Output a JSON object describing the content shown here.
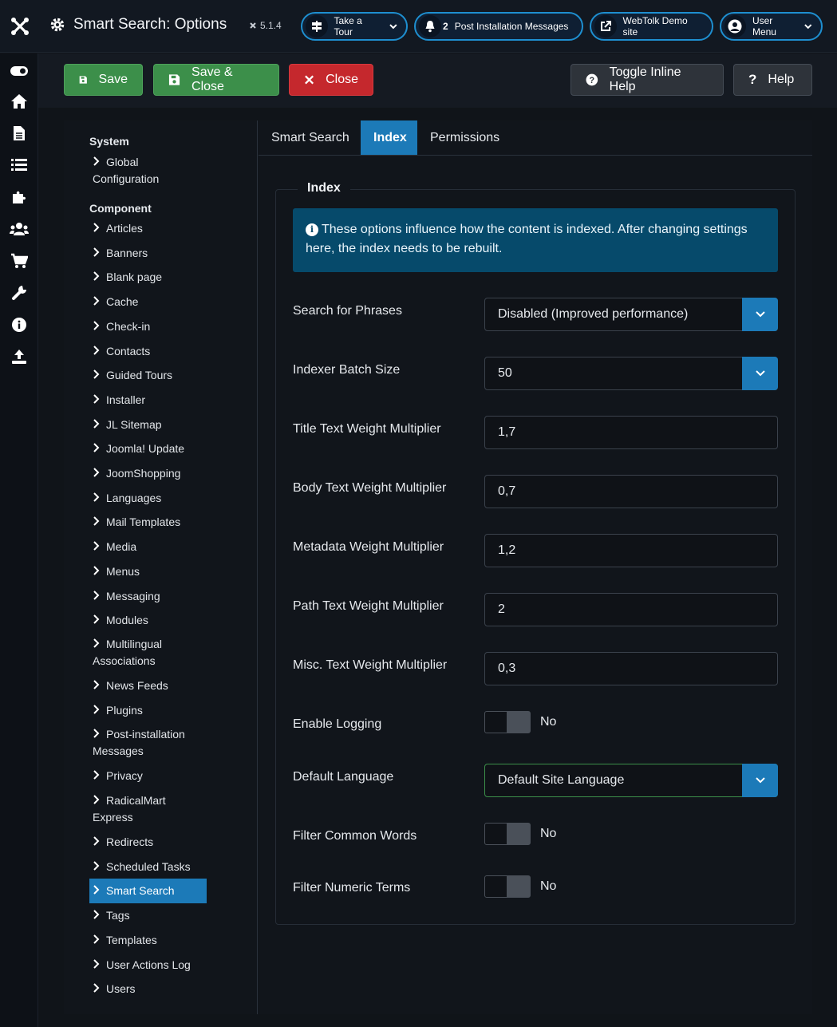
{
  "header": {
    "title": "Smart Search: Options",
    "version": "5.1.4",
    "tour_label": "Take a Tour",
    "notifications_count": "2",
    "notifications_label": "Post Installation Messages",
    "site_label": "WebTolk Demo site",
    "user_menu_label": "User Menu"
  },
  "sidebar_icons": [
    "toggle-icon",
    "home-icon",
    "file-icon",
    "list-icon",
    "puzzle-icon",
    "users-icon",
    "cart-icon",
    "wrench-icon",
    "info-icon",
    "upload-icon"
  ],
  "toolbar": {
    "save": "Save",
    "save_close": "Save & Close",
    "close": "Close",
    "toggle_help": "Toggle Inline Help",
    "help": "Help"
  },
  "nav": {
    "system_heading": "System",
    "global_line1": "Global",
    "global_line2": "Configuration",
    "component_heading": "Component",
    "items": [
      "Articles",
      "Banners",
      "Blank page",
      "Cache",
      "Check-in",
      "Contacts",
      "Guided Tours",
      "Installer",
      "JL Sitemap",
      "Joomla! Update",
      "JoomShopping",
      "Languages",
      "Mail Templates",
      "Media",
      "Menus",
      "Messaging",
      "Modules"
    ],
    "multilingual_line1": "Multilingual",
    "multilingual_line2": "Associations",
    "items2": [
      "News Feeds",
      "Plugins"
    ],
    "postinstall_line1": "Post-installation",
    "postinstall_line2": "Messages",
    "privacy": "Privacy",
    "radical_line1": "RadicalMart",
    "radical_line2": "Express",
    "items3": [
      "Redirects",
      "Scheduled Tasks",
      "Smart Search",
      "Tags",
      "Templates",
      "User Actions Log",
      "Users"
    ],
    "active": "Smart Search"
  },
  "tabs": [
    "Smart Search",
    "Index",
    "Permissions"
  ],
  "active_tab": "Index",
  "form": {
    "legend": "Index",
    "alert_line1": "These options influence how the content is indexed. After changing settings",
    "alert_line2": "here, the index needs to be rebuilt.",
    "fields": {
      "phrases": {
        "label": "Search for Phrases",
        "value": "Disabled (Improved performance)"
      },
      "batch": {
        "label": "Indexer Batch Size",
        "value": "50"
      },
      "title_weight": {
        "label": "Title Text Weight Multiplier",
        "value": "1,7"
      },
      "body_weight": {
        "label": "Body Text Weight Multiplier",
        "value": "0,7"
      },
      "meta_weight": {
        "label": "Metadata Weight Multiplier",
        "value": "1,2"
      },
      "path_weight": {
        "label": "Path Text Weight Multiplier",
        "value": "2"
      },
      "misc_weight": {
        "label": "Misc. Text Weight Multiplier",
        "value": "0,3"
      },
      "logging": {
        "label": "Enable Logging",
        "value": "No"
      },
      "language": {
        "label": "Default Language",
        "value": "Default Site Language"
      },
      "common_words": {
        "label": "Filter Common Words",
        "value": "No"
      },
      "numeric": {
        "label": "Filter Numeric Terms",
        "value": "No"
      }
    }
  },
  "colors": {
    "accent": "#1c7ab8",
    "save": "#3c8f4a",
    "close": "#c5282d",
    "alert": "#064a6b"
  }
}
